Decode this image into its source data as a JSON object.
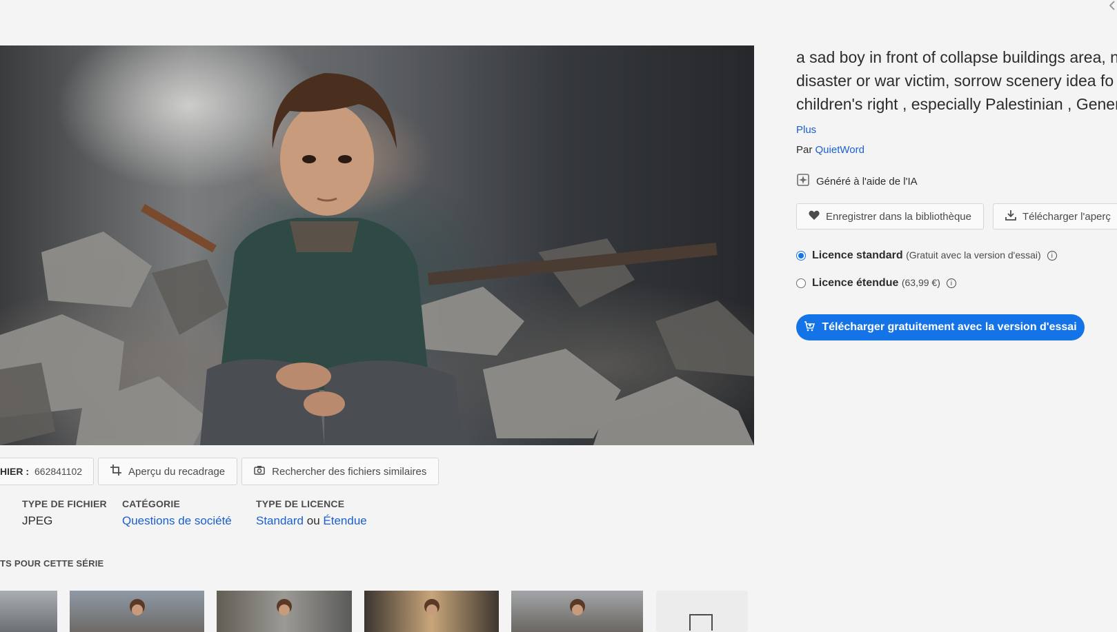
{
  "title_lines": [
    "a sad boy in front of collapse buildings area, n",
    "disaster or war victim, sorrow scenery idea fo",
    "children's right , especially Palestinian , Gener"
  ],
  "more_label": "Plus",
  "byline": {
    "prefix": "Par",
    "author": "QuietWord"
  },
  "ai_label": "Généré à l'aide de l'IA",
  "buttons": {
    "save": "Enregistrer dans la bibliothèque",
    "download_preview": "Télécharger l'aperç"
  },
  "licenses": [
    {
      "name": "Licence standard",
      "detail": "(Gratuit avec la version d'essai)",
      "selected": true
    },
    {
      "name": "Licence étendue",
      "detail": "(63,99 €)",
      "selected": false
    }
  ],
  "cta_label": "Télécharger gratuitement avec la version d'essai",
  "file": {
    "id_label": "HIER :",
    "id_value": "662841102"
  },
  "tools": {
    "crop": "Aperçu du recadrage",
    "similar": "Rechercher des fichiers similaires"
  },
  "meta": {
    "file_type": {
      "header": "TYPE DE FICHIER",
      "value": "JPEG"
    },
    "category": {
      "header": "CATÉGORIE",
      "value": "Questions de société"
    },
    "license_type": {
      "header": "TYPE DE LICENCE",
      "standard": "Standard",
      "or": "ou",
      "extended": "Étendue"
    }
  },
  "series_label": "TS POUR CETTE SÉRIE",
  "colors": {
    "accent": "#1473e6",
    "link": "#1a5fd0"
  }
}
